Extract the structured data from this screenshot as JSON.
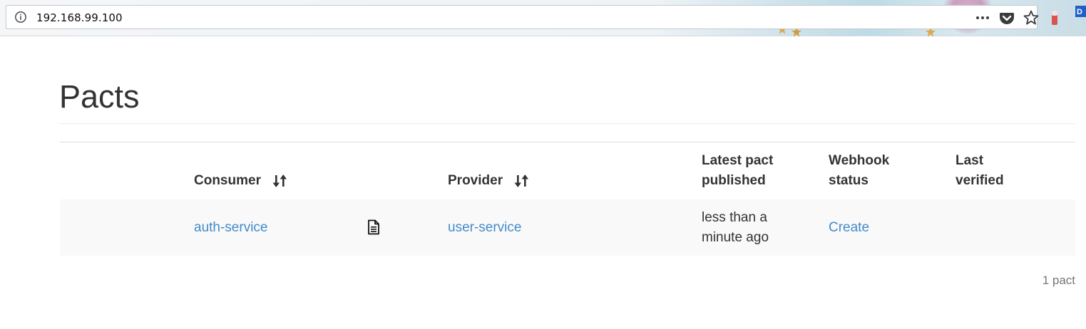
{
  "browser": {
    "url": "192.168.99.100",
    "icons": {
      "site_info": "info-circle-icon",
      "page_actions": "more-dots-icon",
      "pocket": "pocket-icon",
      "bookmark": "star-icon"
    },
    "colors": {
      "toolbar": "#eef3f6",
      "urlbar_border": "#c5c9cf"
    }
  },
  "page": {
    "title": "Pacts",
    "table": {
      "headers": {
        "consumer": "Consumer",
        "provider": "Provider",
        "latest_pact_line1": "Latest pact",
        "latest_pact_line2": "published",
        "webhook_line1": "Webhook",
        "webhook_line2": "status",
        "last_verified_line1": "Last",
        "last_verified_line2": "verified"
      },
      "rows": [
        {
          "consumer": "auth-service",
          "pact_icon": "document-icon",
          "provider": "user-service",
          "published_line1": "less than a",
          "published_line2": "minute ago",
          "webhook_status": "Create",
          "last_verified": ""
        }
      ]
    },
    "count_text": "1 pact",
    "colors": {
      "link": "#428bca",
      "text": "#333333",
      "row_stripe": "#f9f9f9",
      "muted": "#777777"
    }
  }
}
